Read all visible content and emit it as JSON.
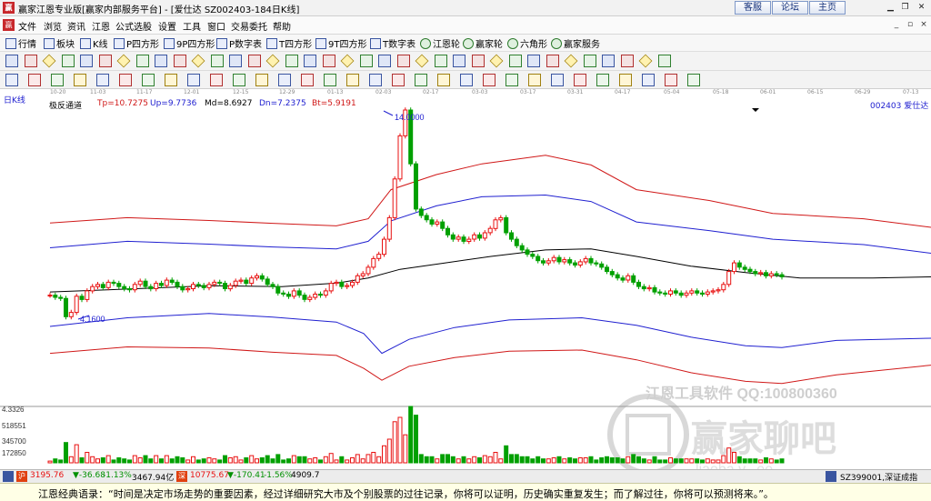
{
  "window": {
    "title": "赢家江恩专业版[赢家内部服务平台] - [爱仕达  SZ002403-184日K线]",
    "logo": "赢",
    "btn_customer": "客服",
    "btn_forum": "论坛",
    "btn_home": "主页"
  },
  "menu": [
    "文件",
    "浏览",
    "资讯",
    "江恩",
    "公式选股",
    "设置",
    "工具",
    "窗口",
    "交易委托",
    "帮助"
  ],
  "toolbar1": [
    "行情",
    "板块",
    "K线",
    "P四方形",
    "9P四方形",
    "P数字表",
    "T四方形",
    "9T四方形",
    "T数字表",
    "江恩轮",
    "赢家轮",
    "六角形",
    "赢家服务"
  ],
  "dates": [
    "10-20",
    "11-03",
    "11-17",
    "12-01",
    "12-15",
    "12-29",
    "01-13",
    "02-03",
    "02-17",
    "03-03",
    "03-17",
    "03-31",
    "04-17",
    "05-04",
    "05-18",
    "06-01",
    "06-15",
    "06-29",
    "07-13"
  ],
  "chart": {
    "period_label": "日K线",
    "indicator_name": "极反通道",
    "tp": "Tp=10.7275",
    "up": "Up=9.7736",
    "md": "Md=8.6927",
    "dn": "Dn=7.2375",
    "bt": "Bt=5.9191",
    "stock_label": "002403  爱仕达",
    "high_label": "14.0000",
    "low_label": "4.1600",
    "vol_labels": [
      "4.3326",
      "518551",
      "345700",
      "172850"
    ]
  },
  "watermark": {
    "line1": "江恩工具软件   QQ:100800360",
    "line2": "赢家聊吧",
    "line3": "ljaoba.v...ee"
  },
  "colors": {
    "up": "#e81010",
    "down": "#00a000",
    "upper": "#d01818",
    "mid": "#2020d0",
    "center": "#000000"
  },
  "status": {
    "idx1_val": "3195.76",
    "idx1_chg": "▼-36.68",
    "idx1_pct": "-1.13%",
    "idx1_amt": "3467.94亿",
    "idx2_val": "10775.67",
    "idx2_chg": "▼-170.41",
    "idx2_pct": "-1.56%",
    "idx2_amt": "4909.7",
    "right": "SZ399001,深证成指"
  },
  "quote": "江恩经典语录：“时间是决定市场走势的重要因素，经过详细研究大市及个别股票的过往记录，你将可以证明，历史确实重复发生；而了解过往，你将可以预测将来。”。"
}
